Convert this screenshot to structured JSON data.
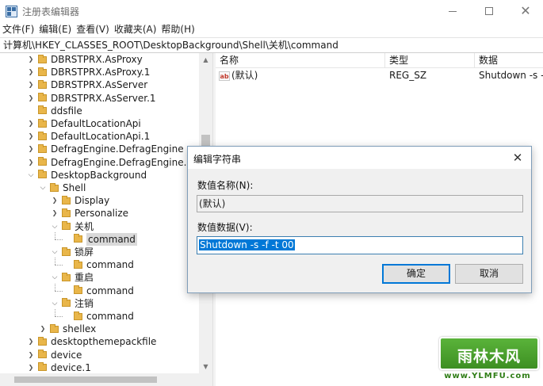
{
  "window": {
    "title": "注册表编辑器"
  },
  "menu": [
    "文件(F)",
    "编辑(E)",
    "查看(V)",
    "收藏夹(A)",
    "帮助(H)"
  ],
  "address": "计算机\\HKEY_CLASSES_ROOT\\DesktopBackground\\Shell\\关机\\command",
  "tree": [
    {
      "label": "DBRSTPRX.AsProxy",
      "level": 0,
      "state": "collapsed"
    },
    {
      "label": "DBRSTPRX.AsProxy.1",
      "level": 0,
      "state": "collapsed"
    },
    {
      "label": "DBRSTPRX.AsServer",
      "level": 0,
      "state": "collapsed"
    },
    {
      "label": "DBRSTPRX.AsServer.1",
      "level": 0,
      "state": "collapsed"
    },
    {
      "label": "ddsfile",
      "level": 0,
      "state": "leaf"
    },
    {
      "label": "DefaultLocationApi",
      "level": 0,
      "state": "collapsed"
    },
    {
      "label": "DefaultLocationApi.1",
      "level": 0,
      "state": "collapsed"
    },
    {
      "label": "DefragEngine.DefragEngine",
      "level": 0,
      "state": "collapsed"
    },
    {
      "label": "DefragEngine.DefragEngine.1",
      "level": 0,
      "state": "collapsed"
    },
    {
      "label": "DesktopBackground",
      "level": 0,
      "state": "expanded"
    },
    {
      "label": "Shell",
      "level": 1,
      "state": "expanded"
    },
    {
      "label": "Display",
      "level": 2,
      "state": "collapsed"
    },
    {
      "label": "Personalize",
      "level": 2,
      "state": "collapsed"
    },
    {
      "label": "关机",
      "level": 2,
      "state": "expanded"
    },
    {
      "label": "command",
      "level": 3,
      "state": "leaf",
      "selected": true
    },
    {
      "label": "锁屏",
      "level": 2,
      "state": "expanded"
    },
    {
      "label": "command",
      "level": 3,
      "state": "leaf"
    },
    {
      "label": "重启",
      "level": 2,
      "state": "expanded"
    },
    {
      "label": "command",
      "level": 3,
      "state": "leaf"
    },
    {
      "label": "注销",
      "level": 2,
      "state": "expanded"
    },
    {
      "label": "command",
      "level": 3,
      "state": "leaf"
    },
    {
      "label": "shellex",
      "level": 1,
      "state": "collapsed"
    },
    {
      "label": "desktopthemepackfile",
      "level": 0,
      "state": "collapsed"
    },
    {
      "label": "device",
      "level": 0,
      "state": "collapsed"
    },
    {
      "label": "device.1",
      "level": 0,
      "state": "collapsed"
    }
  ],
  "list": {
    "columns": [
      "名称",
      "类型",
      "数据"
    ],
    "rows": [
      {
        "icon": "ab",
        "name": "(默认)",
        "type": "REG_SZ",
        "data": "Shutdown -s -t"
      }
    ]
  },
  "dialog": {
    "title": "编辑字符串",
    "name_label": "数值名称(N):",
    "name_value": "(默认)",
    "data_label": "数值数据(V):",
    "data_value": "Shutdown -s -f -t 00",
    "ok": "确定",
    "cancel": "取消"
  },
  "watermark": {
    "text": "雨林木风",
    "url": "www.YLMFU.com"
  },
  "icons": {
    "tree_chevron_collapsed": "chevron-right-icon",
    "tree_chevron_expanded": "chevron-down-icon",
    "folder": "folder-icon",
    "string_value": "ab-string-icon"
  },
  "colors": {
    "selection": "#0078d7",
    "folder": "#e9b64a"
  }
}
